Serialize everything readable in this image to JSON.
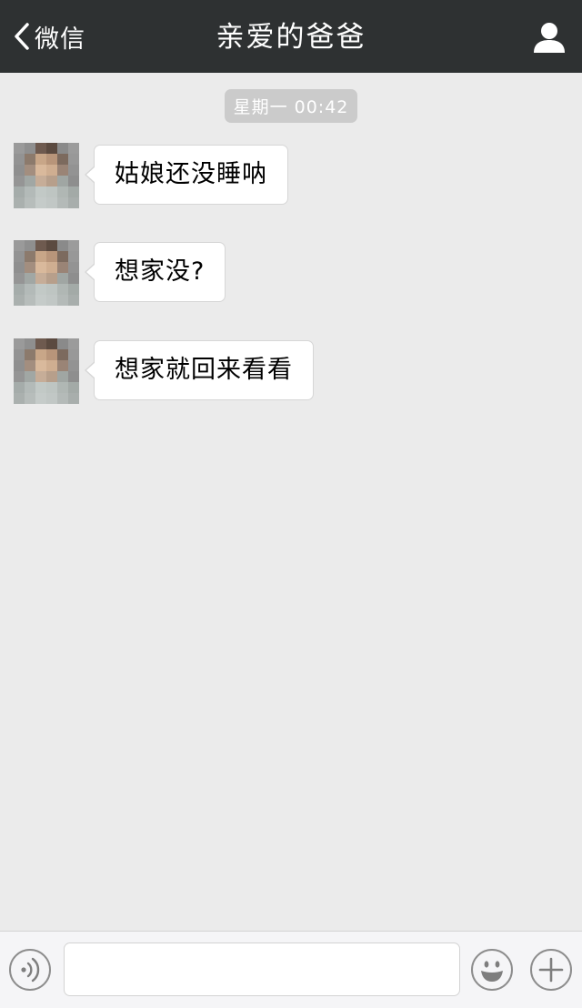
{
  "header": {
    "back_label": "微信",
    "title": "亲爱的爸爸",
    "back_icon": "chevron-left-icon",
    "profile_icon": "person-icon"
  },
  "chat": {
    "timestamp": "星期一 00:42",
    "messages": [
      {
        "sender": "contact",
        "text": "姑娘还没睡呐"
      },
      {
        "sender": "contact",
        "text": "想家没?"
      },
      {
        "sender": "contact",
        "text": "想家就回来看看"
      }
    ]
  },
  "input_bar": {
    "voice_icon": "voice-icon",
    "emoji_icon": "emoji-icon",
    "plus_icon": "plus-icon",
    "text_value": ""
  },
  "colors": {
    "navbar_bg": "#2e3132",
    "chat_bg": "#ebebeb",
    "bubble_bg": "#ffffff",
    "timestamp_bg": "#cbcbcb"
  }
}
